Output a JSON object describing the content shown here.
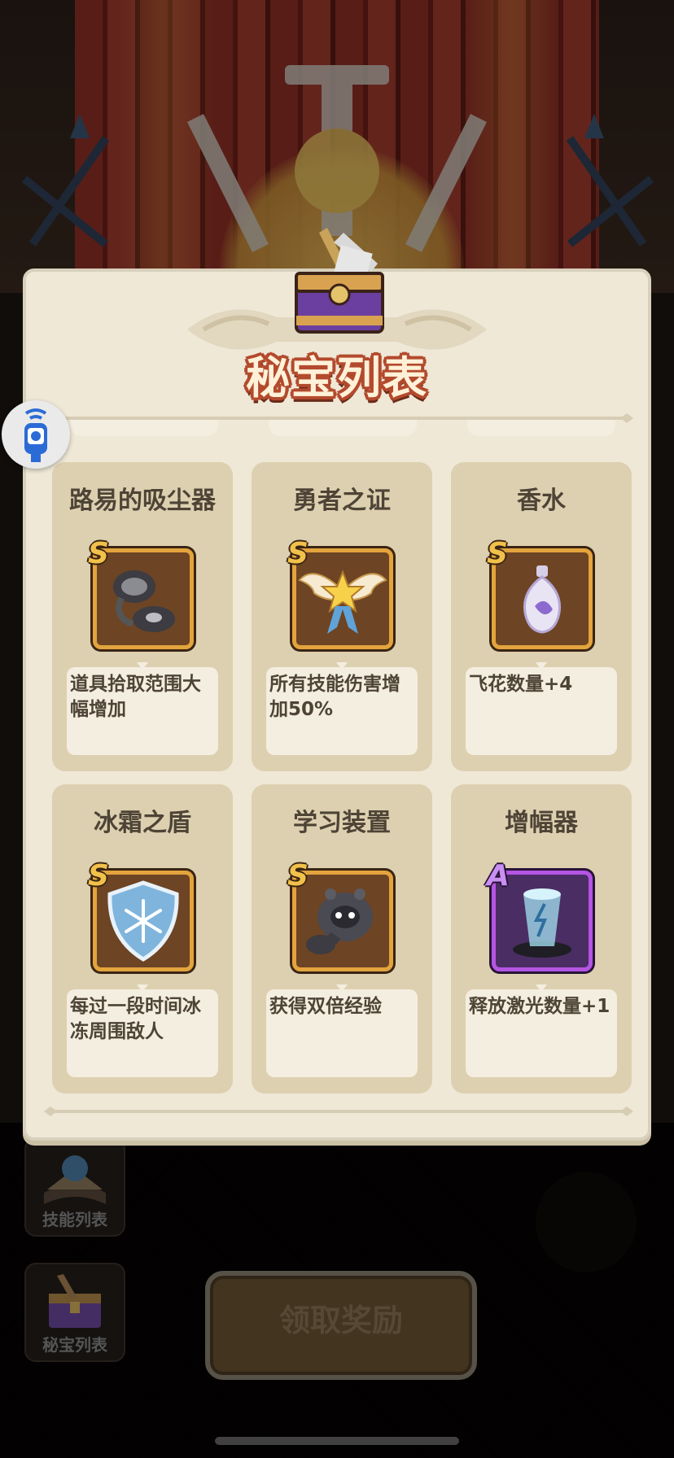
{
  "modal": {
    "title": "秘宝列表"
  },
  "items": [
    {
      "name": "路易的吸尘器",
      "rank": "S",
      "desc": "道具拾取范围大幅增加",
      "icon": "vacuum-icon"
    },
    {
      "name": "勇者之证",
      "rank": "S",
      "desc": "所有技能伤害增加50%",
      "icon": "winged-star-badge-icon"
    },
    {
      "name": "香水",
      "rank": "S",
      "desc": "飞花数量+4",
      "icon": "perfume-bottle-icon"
    },
    {
      "name": "冰霜之盾",
      "rank": "S",
      "desc": "每过一段时间冰冻周围敌人",
      "icon": "frost-shield-icon"
    },
    {
      "name": "学习装置",
      "rank": "S",
      "desc": "获得双倍经验",
      "icon": "learning-device-icon"
    },
    {
      "name": "增幅器",
      "rank": "A",
      "desc": "释放激光数量+1",
      "icon": "amplifier-icon"
    }
  ],
  "bottom": {
    "skill_list_label": "技能列表",
    "treasure_list_label": "秘宝列表",
    "claim_label": "领取奖励"
  },
  "colors": {
    "panel_bg": "#efe8d7",
    "card_bg": "#ddd0b0",
    "title_outline": "#b34a2d",
    "rank_s": "#f2c14a",
    "rank_a": "#c98ff2"
  }
}
